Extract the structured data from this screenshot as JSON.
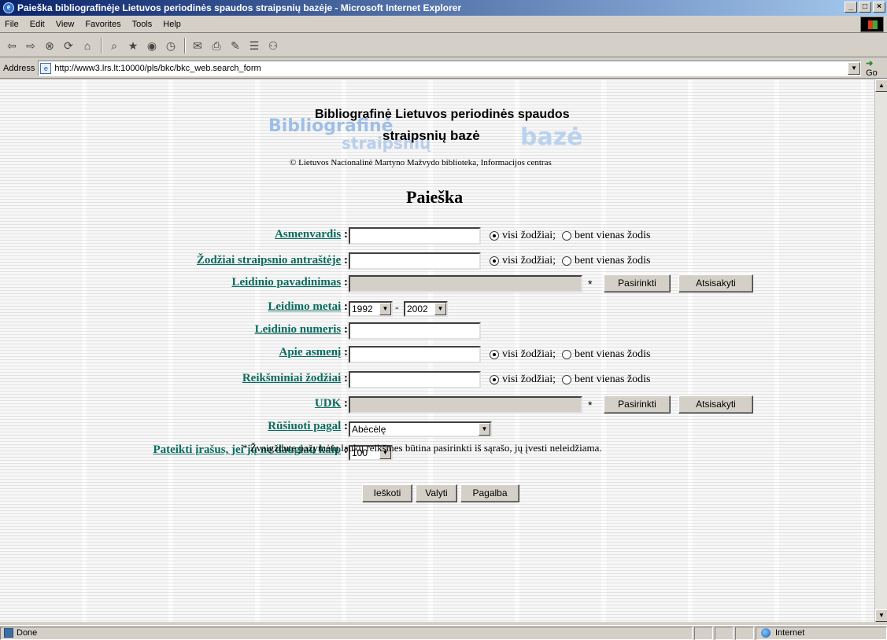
{
  "window": {
    "title": "Paieška bibliografinėje Lietuvos periodinės spaudos straipsnių bazėje - Microsoft Internet Explorer"
  },
  "menu": [
    "File",
    "Edit",
    "View",
    "Favorites",
    "Tools",
    "Help"
  ],
  "address": {
    "label": "Address",
    "url": "http://www3.lrs.lt:10000/pls/bkc/bkc_web.search_form",
    "go": "Go"
  },
  "header": {
    "logo_bg_word1": "Bibliografinė",
    "logo_bg_word2": "straipsnių",
    "logo_bg_word3": "bazė",
    "line1": "Bibliografinė Lietuvos periodinės spaudos",
    "line2": "straipsnių bazė",
    "copyright": "© Lietuvos Nacionalinė Martyno Mažvydo biblioteka, Informacijos centras"
  },
  "page_title": "Paieška",
  "fields": {
    "asmenvardis": "Asmenvardis",
    "zodziai": "Žodžiai straipsnio antraštėje",
    "leidinio_pavadinimas": "Leidinio pavadinimas",
    "leidimo_metai": "Leidimo metai",
    "leidinio_numeris": "Leidinio numeris",
    "apie_asmeni": "Apie asmenį",
    "reiksminiai": "Reikšminiai žodžiai",
    "udk": "UDK",
    "rusiuoti": "Rūšiuoti pagal",
    "pateikti": "Pateikti įrašus, jei jų ne daugiau kaip"
  },
  "colon": ":",
  "radio": {
    "all": "visi žodžiai;",
    "any": "bent vienas žodis"
  },
  "star": "*",
  "buttons": {
    "choose": "Pasirinkti",
    "cancel": "Atsisakyti",
    "search": "Ieškoti",
    "clear": "Valyti",
    "help": "Pagalba"
  },
  "years": {
    "from": "1992",
    "dash": "-",
    "to": "2002"
  },
  "sort_value": "Abėcėlę",
  "limit_value": "100",
  "note": "* Žvaigždute pažymėtų laukų reikšmes būtina pasirinkti iš sąrašo, jų įvesti neleidžiama.",
  "status": {
    "done": "Done",
    "zone": "Internet"
  }
}
